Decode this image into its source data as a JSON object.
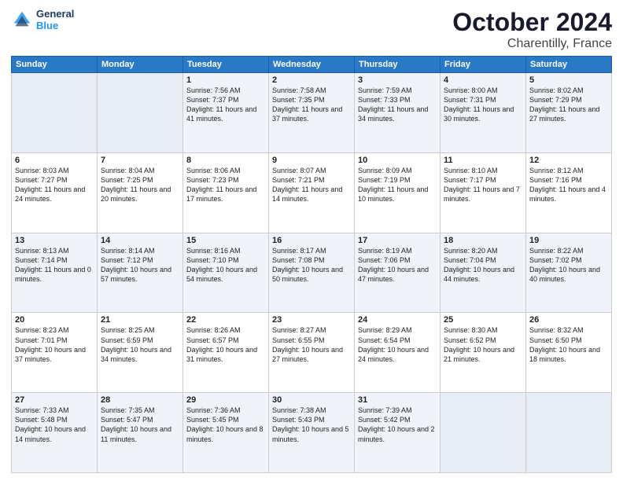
{
  "header": {
    "logo_line1": "General",
    "logo_line2": "Blue",
    "month": "October 2024",
    "location": "Charentilly, France"
  },
  "weekdays": [
    "Sunday",
    "Monday",
    "Tuesday",
    "Wednesday",
    "Thursday",
    "Friday",
    "Saturday"
  ],
  "weeks": [
    [
      {
        "day": "",
        "info": ""
      },
      {
        "day": "",
        "info": ""
      },
      {
        "day": "1",
        "info": "Sunrise: 7:56 AM\nSunset: 7:37 PM\nDaylight: 11 hours and 41 minutes."
      },
      {
        "day": "2",
        "info": "Sunrise: 7:58 AM\nSunset: 7:35 PM\nDaylight: 11 hours and 37 minutes."
      },
      {
        "day": "3",
        "info": "Sunrise: 7:59 AM\nSunset: 7:33 PM\nDaylight: 11 hours and 34 minutes."
      },
      {
        "day": "4",
        "info": "Sunrise: 8:00 AM\nSunset: 7:31 PM\nDaylight: 11 hours and 30 minutes."
      },
      {
        "day": "5",
        "info": "Sunrise: 8:02 AM\nSunset: 7:29 PM\nDaylight: 11 hours and 27 minutes."
      }
    ],
    [
      {
        "day": "6",
        "info": "Sunrise: 8:03 AM\nSunset: 7:27 PM\nDaylight: 11 hours and 24 minutes."
      },
      {
        "day": "7",
        "info": "Sunrise: 8:04 AM\nSunset: 7:25 PM\nDaylight: 11 hours and 20 minutes."
      },
      {
        "day": "8",
        "info": "Sunrise: 8:06 AM\nSunset: 7:23 PM\nDaylight: 11 hours and 17 minutes."
      },
      {
        "day": "9",
        "info": "Sunrise: 8:07 AM\nSunset: 7:21 PM\nDaylight: 11 hours and 14 minutes."
      },
      {
        "day": "10",
        "info": "Sunrise: 8:09 AM\nSunset: 7:19 PM\nDaylight: 11 hours and 10 minutes."
      },
      {
        "day": "11",
        "info": "Sunrise: 8:10 AM\nSunset: 7:17 PM\nDaylight: 11 hours and 7 minutes."
      },
      {
        "day": "12",
        "info": "Sunrise: 8:12 AM\nSunset: 7:16 PM\nDaylight: 11 hours and 4 minutes."
      }
    ],
    [
      {
        "day": "13",
        "info": "Sunrise: 8:13 AM\nSunset: 7:14 PM\nDaylight: 11 hours and 0 minutes."
      },
      {
        "day": "14",
        "info": "Sunrise: 8:14 AM\nSunset: 7:12 PM\nDaylight: 10 hours and 57 minutes."
      },
      {
        "day": "15",
        "info": "Sunrise: 8:16 AM\nSunset: 7:10 PM\nDaylight: 10 hours and 54 minutes."
      },
      {
        "day": "16",
        "info": "Sunrise: 8:17 AM\nSunset: 7:08 PM\nDaylight: 10 hours and 50 minutes."
      },
      {
        "day": "17",
        "info": "Sunrise: 8:19 AM\nSunset: 7:06 PM\nDaylight: 10 hours and 47 minutes."
      },
      {
        "day": "18",
        "info": "Sunrise: 8:20 AM\nSunset: 7:04 PM\nDaylight: 10 hours and 44 minutes."
      },
      {
        "day": "19",
        "info": "Sunrise: 8:22 AM\nSunset: 7:02 PM\nDaylight: 10 hours and 40 minutes."
      }
    ],
    [
      {
        "day": "20",
        "info": "Sunrise: 8:23 AM\nSunset: 7:01 PM\nDaylight: 10 hours and 37 minutes."
      },
      {
        "day": "21",
        "info": "Sunrise: 8:25 AM\nSunset: 6:59 PM\nDaylight: 10 hours and 34 minutes."
      },
      {
        "day": "22",
        "info": "Sunrise: 8:26 AM\nSunset: 6:57 PM\nDaylight: 10 hours and 31 minutes."
      },
      {
        "day": "23",
        "info": "Sunrise: 8:27 AM\nSunset: 6:55 PM\nDaylight: 10 hours and 27 minutes."
      },
      {
        "day": "24",
        "info": "Sunrise: 8:29 AM\nSunset: 6:54 PM\nDaylight: 10 hours and 24 minutes."
      },
      {
        "day": "25",
        "info": "Sunrise: 8:30 AM\nSunset: 6:52 PM\nDaylight: 10 hours and 21 minutes."
      },
      {
        "day": "26",
        "info": "Sunrise: 8:32 AM\nSunset: 6:50 PM\nDaylight: 10 hours and 18 minutes."
      }
    ],
    [
      {
        "day": "27",
        "info": "Sunrise: 7:33 AM\nSunset: 5:48 PM\nDaylight: 10 hours and 14 minutes."
      },
      {
        "day": "28",
        "info": "Sunrise: 7:35 AM\nSunset: 5:47 PM\nDaylight: 10 hours and 11 minutes."
      },
      {
        "day": "29",
        "info": "Sunrise: 7:36 AM\nSunset: 5:45 PM\nDaylight: 10 hours and 8 minutes."
      },
      {
        "day": "30",
        "info": "Sunrise: 7:38 AM\nSunset: 5:43 PM\nDaylight: 10 hours and 5 minutes."
      },
      {
        "day": "31",
        "info": "Sunrise: 7:39 AM\nSunset: 5:42 PM\nDaylight: 10 hours and 2 minutes."
      },
      {
        "day": "",
        "info": ""
      },
      {
        "day": "",
        "info": ""
      }
    ]
  ]
}
